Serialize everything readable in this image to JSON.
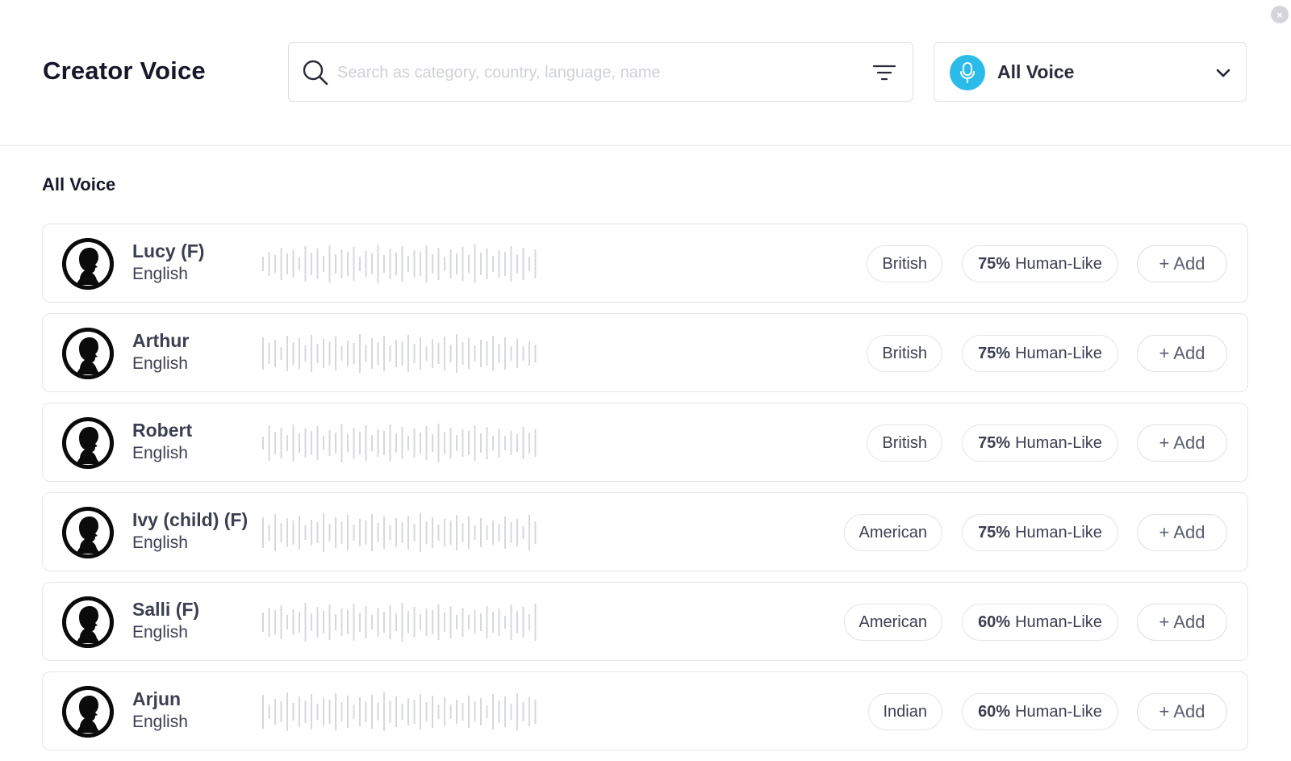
{
  "header": {
    "title": "Creator Voice",
    "search": {
      "placeholder": "Search as category, country, language, name",
      "value": "",
      "icon": "search-icon",
      "filter_icon": "filter-icon"
    },
    "voice_filter": {
      "selected": "All Voice",
      "icon": "microphone-icon",
      "accent_color": "#2bbbe8"
    },
    "close_label": "×"
  },
  "section": {
    "title": "All Voice"
  },
  "add_label": "+ Add",
  "human_like_suffix": "Human-Like",
  "voices": [
    {
      "name": "Lucy (F)",
      "language": "English",
      "accent": "British",
      "human_like": "75%"
    },
    {
      "name": "Arthur",
      "language": "English",
      "accent": "British",
      "human_like": "75%"
    },
    {
      "name": "Robert",
      "language": "English",
      "accent": "British",
      "human_like": "75%"
    },
    {
      "name": "Ivy (child) (F)",
      "language": "English",
      "accent": "American",
      "human_like": "75%"
    },
    {
      "name": "Salli (F)",
      "language": "English",
      "accent": "American",
      "human_like": "60%"
    },
    {
      "name": "Arjun",
      "language": "English",
      "accent": "Indian",
      "human_like": "60%"
    }
  ]
}
